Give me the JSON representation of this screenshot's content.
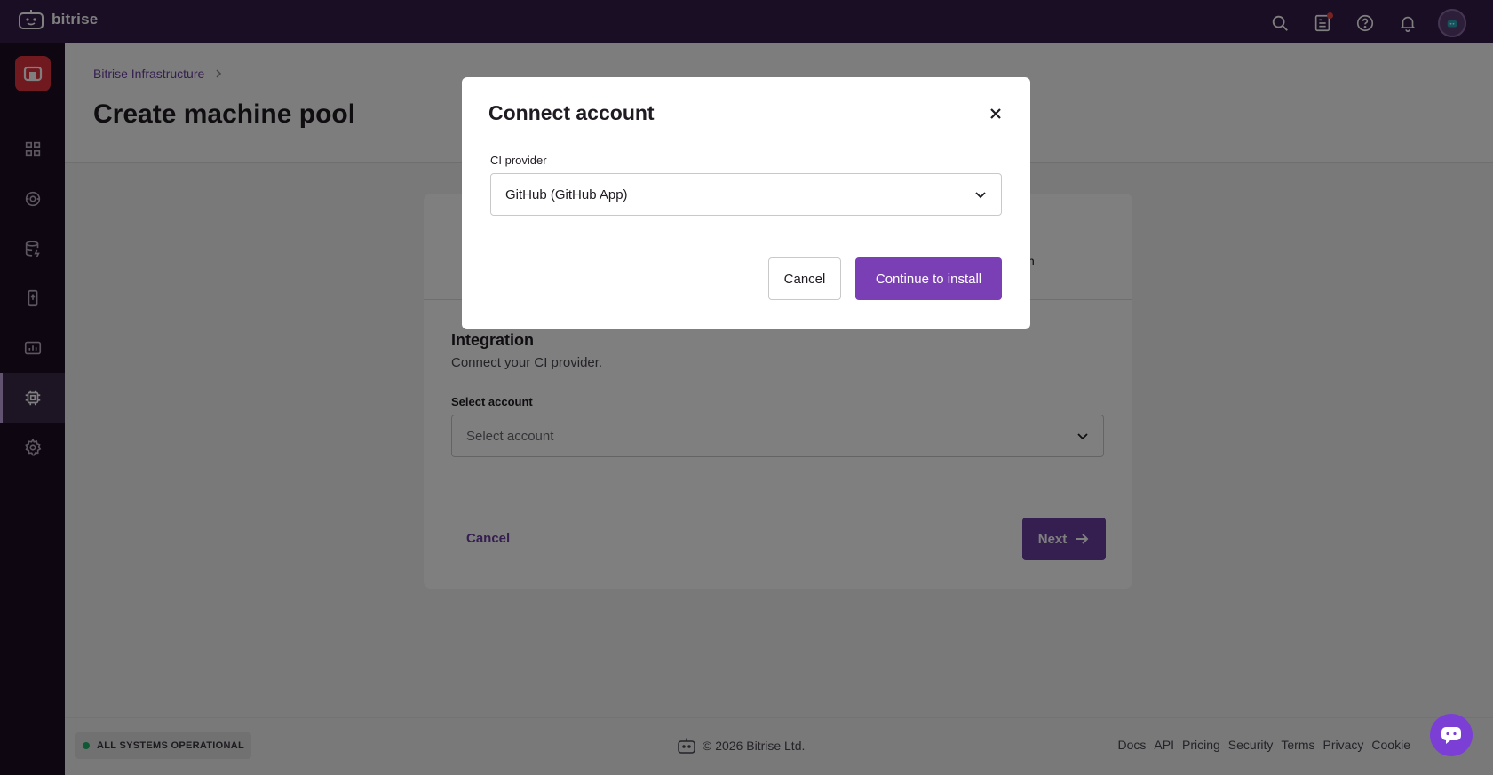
{
  "app": {
    "name": "bitrise"
  },
  "header": {
    "icons": [
      "search-icon",
      "changelog-icon",
      "help-icon",
      "bell-icon",
      "avatar"
    ]
  },
  "sidebar": {
    "workspace_badge": "workspace-icon",
    "items": [
      {
        "icon": "dashboard-icon"
      },
      {
        "icon": "releases-icon"
      },
      {
        "icon": "database-icon"
      },
      {
        "icon": "device-icon"
      },
      {
        "icon": "insights-icon"
      },
      {
        "icon": "chip-icon",
        "active": true
      },
      {
        "icon": "settings-icon"
      }
    ]
  },
  "page": {
    "breadcrumb": "Bitrise Infrastructure",
    "title": "Create machine pool"
  },
  "card": {
    "step_tail_text": "n",
    "section_title": "Integration",
    "section_subtitle": "Connect your CI provider.",
    "select_label": "Select account",
    "select_placeholder": "Select account",
    "cancel_label": "Cancel",
    "next_label": "Next"
  },
  "modal": {
    "title": "Connect account",
    "field_label": "CI provider",
    "selected_provider": "GitHub (GitHub App)",
    "cancel_label": "Cancel",
    "continue_label": "Continue to install"
  },
  "footer": {
    "status": "ALL SYSTEMS OPERATIONAL",
    "copyright": "© 2026 Bitrise Ltd.",
    "links": [
      "Docs",
      "API",
      "Pricing",
      "Security",
      "Terms",
      "Privacy",
      "Cookie"
    ]
  },
  "colors": {
    "topbar": "#351d48",
    "brand_purple": "#6b3fa0",
    "status_green": "#1fb26b"
  }
}
